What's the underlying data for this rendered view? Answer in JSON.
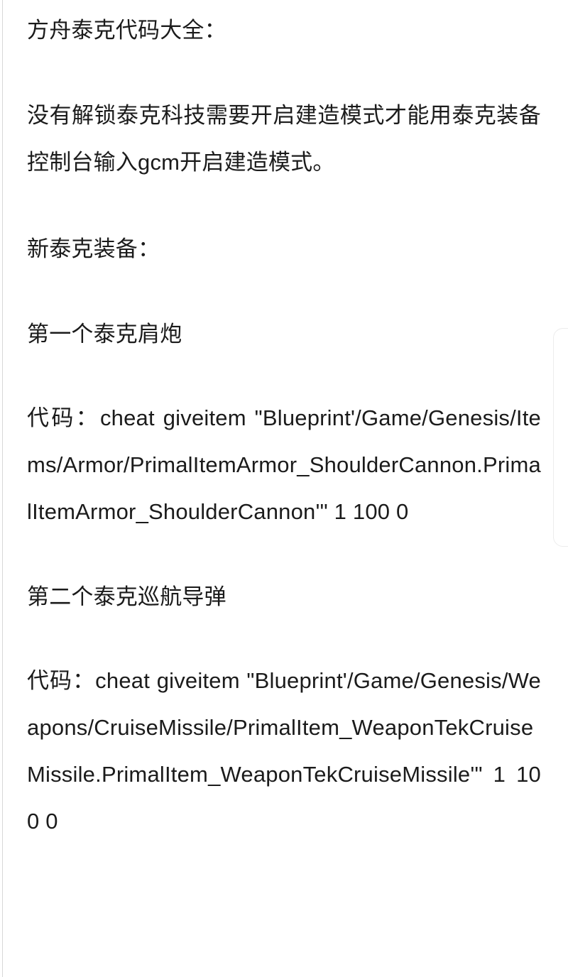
{
  "page": {
    "background_color": "#ffffff",
    "text_color": "#1b1b1b",
    "edge_rule_color": "#d8d8d8",
    "card_border_color": "#ececec"
  },
  "article": {
    "title": "方舟泰克代码大全：",
    "intro": "没有解锁泰克科技需要开启建造模式才能用泰克装备 控制台输入gcm开启建造模式。",
    "section_heading": "新泰克装备：",
    "entries": [
      {
        "name": "第一个泰克肩炮",
        "code": "代码：cheat giveitem \"Blueprint'/Game/Genesis/Items/Armor/PrimalItemArmor_ShoulderCannon.PrimalItemArmor_ShoulderCannon'\" 1 100 0"
      },
      {
        "name": "第二个泰克巡航导弹",
        "code": "代码：cheat giveitem \"Blueprint'/Game/Genesis/Weapons/CruiseMissile/PrimalItem_WeaponTekCruiseMissile.PrimalItem_WeaponTekCruiseMissile'\" 1 100 0"
      }
    ]
  }
}
